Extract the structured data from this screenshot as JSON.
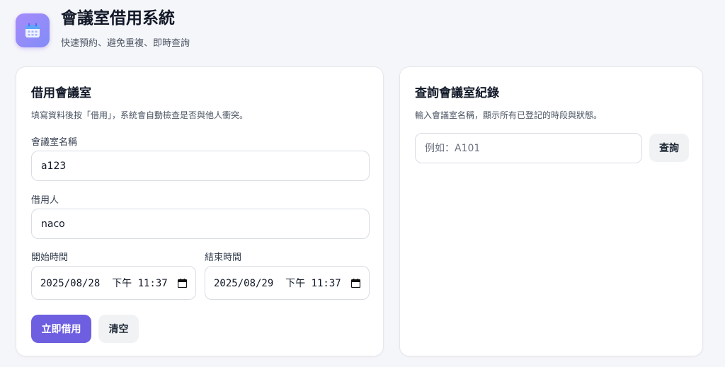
{
  "app": {
    "title": "會議室借用系統",
    "subtitle": "快速預約、避免重複、即時查詢",
    "icon": "calendar-icon"
  },
  "borrow": {
    "title": "借用會議室",
    "description": "填寫資料後按「借用」，系統會自動檢查是否與他人衝突。",
    "room_label": "會議室名稱",
    "room_value": "a123",
    "borrower_label": "借用人",
    "borrower_value": "naco",
    "start_label": "開始時間",
    "start_value": "2025/08/28  下午 11:37",
    "end_label": "結束時間",
    "end_value": "2025/08/29  下午 11:37",
    "submit_label": "立即借用",
    "clear_label": "清空"
  },
  "query": {
    "title": "查詢會議室紀錄",
    "description": "輸入會議室名稱，顯示所有已登記的時段與狀態。",
    "placeholder": "例如：A101",
    "button_label": "查詢"
  },
  "colors": {
    "accent": "#6d5fe0",
    "icon_gradient_start": "#a78bfa",
    "icon_gradient_end": "#818cf8",
    "background": "#f5f6fa"
  }
}
